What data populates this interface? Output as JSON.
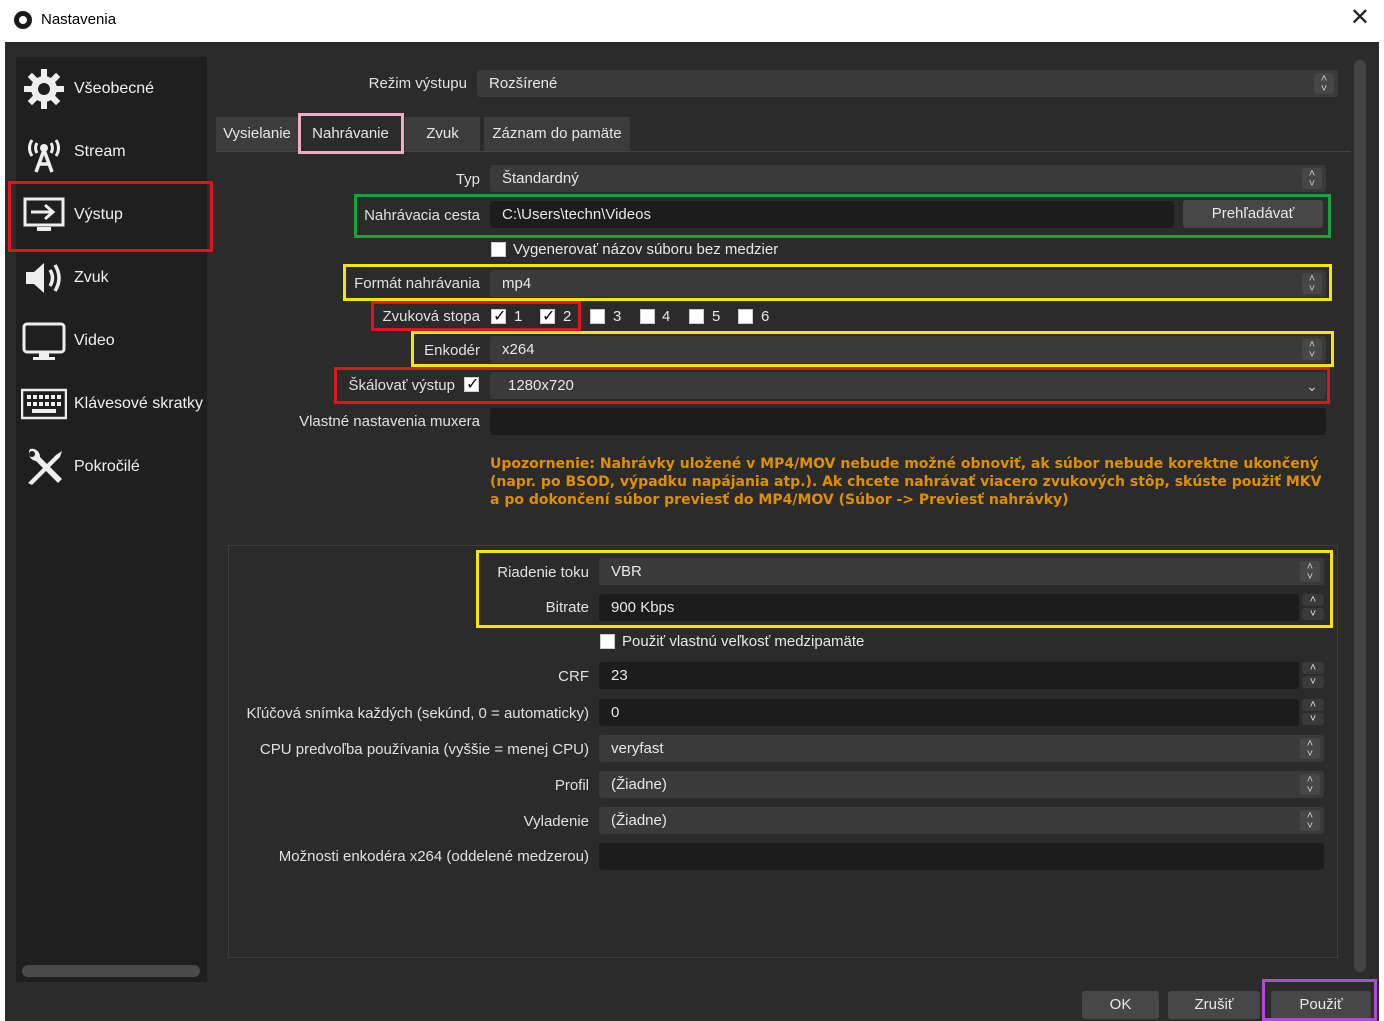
{
  "window": {
    "title": "Nastavenia",
    "close": "✕"
  },
  "sidebar": {
    "items": [
      {
        "label": "Všeobecné",
        "icon": "gear-icon"
      },
      {
        "label": "Stream",
        "icon": "antenna-icon"
      },
      {
        "label": "Výstup",
        "icon": "output-icon"
      },
      {
        "label": "Zvuk",
        "icon": "speaker-icon"
      },
      {
        "label": "Video",
        "icon": "monitor-icon"
      },
      {
        "label": "Klávesové skratky",
        "icon": "keyboard-icon"
      },
      {
        "label": "Pokročilé",
        "icon": "tools-icon"
      }
    ],
    "active": "Výstup"
  },
  "output_mode": {
    "label": "Režim výstupu",
    "value": "Rozšírené"
  },
  "tabs": [
    "Vysielanie",
    "Nahrávanie",
    "Zvuk",
    "Záznam do pamäte"
  ],
  "active_tab": "Nahrávanie",
  "recording": {
    "type_label": "Typ",
    "type_value": "Štandardný",
    "path_label": "Nahrávacia cesta",
    "path_value": "C:\\Users\\techn\\Videos",
    "browse_label": "Prehľadávať",
    "nospace_label": "Vygenerovať názov súboru bez medzier",
    "format_label": "Formát nahrávania",
    "format_value": "mp4",
    "audio_track_label": "Zvuková stopa",
    "tracks": [
      {
        "n": "1",
        "checked": true
      },
      {
        "n": "2",
        "checked": true
      },
      {
        "n": "3",
        "checked": false
      },
      {
        "n": "4",
        "checked": false
      },
      {
        "n": "5",
        "checked": false
      },
      {
        "n": "6",
        "checked": false
      }
    ],
    "encoder_label": "Enkodér",
    "encoder_value": "x264",
    "rescale_label": "Škálovať výstup",
    "rescale_value": "1280x720",
    "muxer_label": "Vlastné nastavenia muxera",
    "muxer_value": "",
    "warning": "Upozornenie: Nahrávky uložené v MP4/MOV nebude možné obnoviť, ak súbor nebude korektne ukončený (napr. po BSOD, výpadku napájania atp.). Ak chcete nahrávať viacero zvukových stôp, skúste použiť MKV a po dokončení súbor previesť do MP4/MOV (Súbor -> Previesť nahrávky)"
  },
  "encoder": {
    "rate_control_label": "Riadenie toku",
    "rate_control_value": "VBR",
    "bitrate_label": "Bitrate",
    "bitrate_value": "900 Kbps",
    "buffer_label": "Použiť vlastnú veľkosť medzipamäte",
    "crf_label": "CRF",
    "crf_value": "23",
    "keyframe_label": "Kľúčová snímka každých (sekúnd, 0 = automaticky)",
    "keyframe_value": "0",
    "preset_label": "CPU predvoľba používania (vyššie = menej CPU)",
    "preset_value": "veryfast",
    "profile_label": "Profil",
    "profile_value": "(Žiadne)",
    "tune_label": "Vyladenie",
    "tune_value": "(Žiadne)",
    "options_label": "Možnosti enkodéra x264 (oddelené medzerou)",
    "options_value": ""
  },
  "buttons": {
    "ok": "OK",
    "cancel": "Zrušiť",
    "apply": "Použiť"
  },
  "colors": {
    "highlight_red": "#e0141e",
    "highlight_green": "#1aa33c",
    "highlight_yellow": "#f5e500",
    "highlight_pink": "#f3a9c8",
    "highlight_purple": "#b14bd3",
    "warning": "#e08f00"
  }
}
